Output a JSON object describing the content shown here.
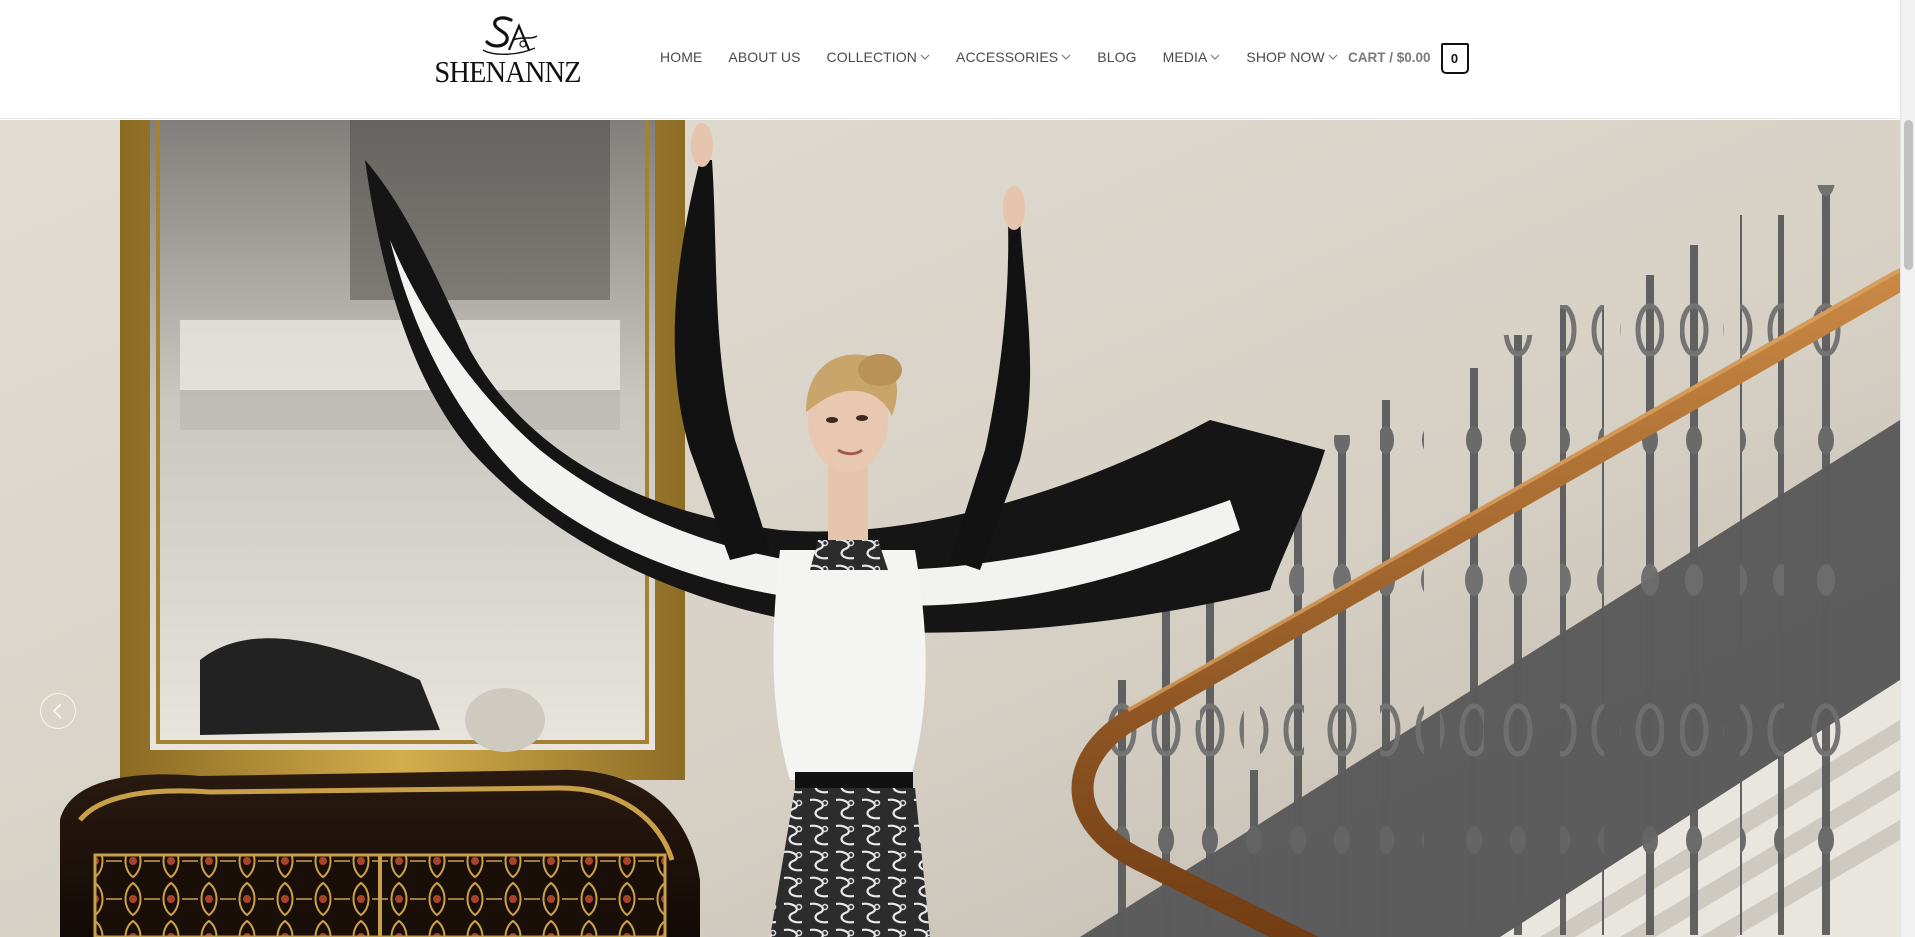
{
  "brand": {
    "logo_text": "SHENANNZ",
    "monogram": "SA"
  },
  "nav": {
    "items": [
      {
        "label": "HOME",
        "has_dropdown": false
      },
      {
        "label": "ABOUT US",
        "has_dropdown": false
      },
      {
        "label": "COLLECTION",
        "has_dropdown": true
      },
      {
        "label": "ACCESSORIES",
        "has_dropdown": true
      },
      {
        "label": "BLOG",
        "has_dropdown": false
      },
      {
        "label": "MEDIA",
        "has_dropdown": true
      },
      {
        "label": "SHOP NOW",
        "has_dropdown": true
      }
    ]
  },
  "cart": {
    "label": "CART / $0.00",
    "count": "0"
  },
  "hero": {
    "slider_prev_icon": "chevron-left-icon"
  },
  "colors": {
    "nav_text": "#4a4a4a",
    "cart_text": "#7a7a7a",
    "wall": "#dcd6cc",
    "gold_frame": "#b8902f",
    "banister_wood": "#a8652a"
  }
}
